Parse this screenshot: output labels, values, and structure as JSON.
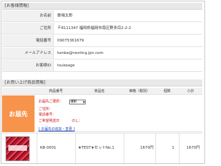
{
  "customer_section": {
    "title": "[お客様情報]",
    "rows": [
      {
        "label": "お名前",
        "value": "数場太郎"
      },
      {
        "label": "ご住所",
        "value": "〒8111347 福岡県福岡市南区野多目2-2-2"
      },
      {
        "label": "電話番号",
        "value": "09075361679"
      },
      {
        "label": "メールアドレス",
        "value": "kanba@nexting.jpn.com"
      },
      {
        "label": "お客様ID",
        "value": "tsukeage"
      }
    ]
  },
  "order_section": {
    "title": "[お買い上げ商品情報]",
    "columns": [
      "商品番号",
      "商品名",
      "価格（税別）",
      "個数",
      "小計"
    ],
    "destination": {
      "label": "お届先",
      "select_prompt": "お届先ご選択：",
      "select_value": "選択",
      "address_label": "ご住所：",
      "phone_label": "電話番号：",
      "date_label": "ご希望発送日",
      "date_value": "のし：",
      "add_change_link": "[ お届先の追加・変更 ]"
    },
    "item": {
      "code": "KB-0001",
      "name": "★TEST★セットNo.1",
      "price": "1670円",
      "qty": "1",
      "subtotal": "1670円"
    }
  },
  "colors": {
    "destination_bg": "#f7934a",
    "required_text": "#cc1111",
    "link": "#1a3fb5"
  }
}
